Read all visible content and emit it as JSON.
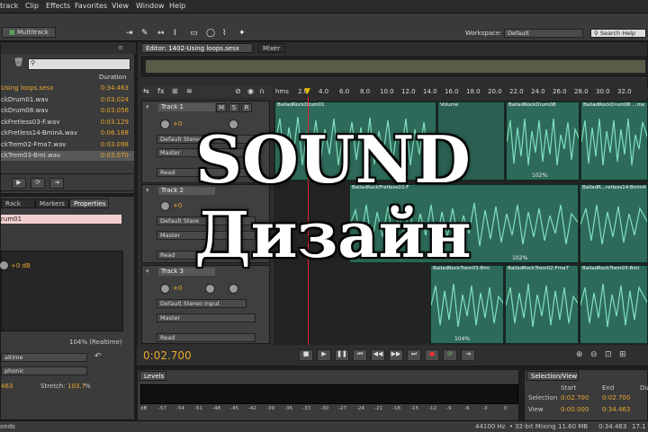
{
  "menu": [
    "track",
    "Clip",
    "Effects",
    "Favorites",
    "View",
    "Window",
    "Help"
  ],
  "toolbar": {
    "mode": "Multitrack",
    "workspace_label": "Workspace:",
    "workspace_value": "Default",
    "search_help": "Search Help"
  },
  "files_panel": {
    "duration_header": "Duration",
    "files": [
      {
        "name": "Using loops.sesx",
        "duration": "0:34.463"
      },
      {
        "name": "ckDrum01.wav",
        "duration": "0:03.024"
      },
      {
        "name": "ckDrum08.wav",
        "duration": "0:03.056"
      },
      {
        "name": "ckFretless03-F.wav",
        "duration": "0:03.129"
      },
      {
        "name": "ckFretless14-BminA.wav",
        "duration": "0:06.168"
      },
      {
        "name": "ckTrem02-Fma7.wav",
        "duration": "0:03.098"
      },
      {
        "name": "ckTrem03-Bmi.wav",
        "duration": "0:03.070"
      }
    ]
  },
  "lower_tabs": [
    "Rack",
    "Markers",
    "Properties"
  ],
  "properties": {
    "clip_name": "rum01",
    "volume": "+0 dB",
    "percent": "104%  (Realtime)",
    "mode": "altime",
    "type": "phonic",
    "value_left": "463",
    "stretch_label": "Stretch:",
    "stretch_value": "103.7",
    "stretch_unit": "%"
  },
  "editor": {
    "tab": "Editor: 1402-Using loops.sesx",
    "mixer_tab": "Mixer",
    "time": "0:02.700"
  },
  "ruler": [
    "hms",
    "2.0",
    "4.0",
    "6.0",
    "8.0",
    "10.0",
    "12.0",
    "14.0",
    "16.0",
    "18.0",
    "20.0",
    "22.0",
    "24.0",
    "26.0",
    "28.0",
    "30.0",
    "32.0"
  ],
  "tracks": [
    {
      "name": "Track 1",
      "volume": "+0",
      "input": "Default Stereo",
      "output": "Master",
      "auto": "Read"
    },
    {
      "name": "Track 2",
      "volume": "+0",
      "input": "Default Stere",
      "output": "Master",
      "auto": "Read"
    },
    {
      "name": "Track 3",
      "volume": "+0",
      "input": "Default Stereo Input",
      "output": "Master",
      "auto": "Read"
    }
  ],
  "clips": {
    "t1a": "BalladRockDrum01",
    "t1b": "Volume",
    "t1c": "BalladRockDrum08",
    "t1d": "BalladRockDrum08 ...me",
    "t2a": "BalladRockFretless03-F",
    "t2b": "BalladR...retless14-BminA",
    "t3a": "BalladRockTrem02-Fma7",
    "t3b": "BalladRockTrem03-Bmi",
    "pct": "102%",
    "pct2": "104%"
  },
  "overlay": {
    "line1": "SOUND",
    "line2": "Дизайн"
  },
  "levels": {
    "title": "Levels",
    "scale": [
      "dB",
      "-57",
      "-54",
      "-51",
      "-48",
      "-45",
      "-42",
      "-39",
      "-36",
      "-33",
      "-30",
      "-27",
      "-24",
      "-21",
      "-18",
      "-15",
      "-12",
      "-9",
      "-6",
      "-3",
      "0"
    ]
  },
  "selection_view": {
    "title": "Selection/View",
    "start_label": "Start",
    "end_label": "End",
    "dur_label": "Du",
    "selection_label": "Selection",
    "view_label": "View",
    "sel_start": "0:02.700",
    "sel_end": "0:02.700",
    "view_start": "0:00.000",
    "view_end": "0:34.463"
  },
  "status": {
    "left": "onds",
    "rate": "44100 Hz",
    "bits": "32-bit Mixing",
    "size": "11.60 MB",
    "dur": "0:34.463",
    "free": "17.1"
  }
}
